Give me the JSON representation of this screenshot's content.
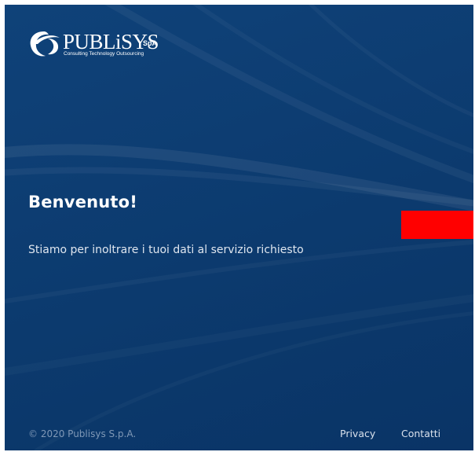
{
  "brand": {
    "name": "PUBLiSYS",
    "suffix": "SpA",
    "tagline": "Consulting Technology Outsourcing",
    "logo_icon": "crescent-swoosh-icon"
  },
  "main": {
    "heading": "Benvenuto!",
    "message": "Stiamo per inoltrare i tuoi dati al servizio richiesto"
  },
  "footer": {
    "copyright": "© 2020 Publisys S.p.A.",
    "links": [
      {
        "label": "Privacy"
      },
      {
        "label": "Contatti"
      }
    ]
  },
  "colors": {
    "background": "#0d3d72",
    "accent": "#ff0000",
    "text": "#ffffff",
    "muted_text": "#7f98b6"
  }
}
